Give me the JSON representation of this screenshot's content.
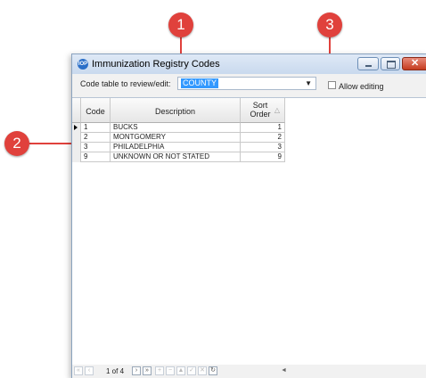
{
  "window": {
    "title": "Immunization Registry Codes",
    "app_icon_text": "IOP"
  },
  "toolbar": {
    "code_table_label": "Code table to review/edit:",
    "code_table_value": "COUNTY",
    "allow_editing_label": "Allow editing",
    "allow_editing_checked": false
  },
  "grid": {
    "columns": [
      "Code",
      "Description",
      "Sort Order"
    ],
    "sorted_column": "Sort Order",
    "rows": [
      {
        "code": "1",
        "description": "BUCKS",
        "sort": "1"
      },
      {
        "code": "2",
        "description": "MONTGOMERY",
        "sort": "2"
      },
      {
        "code": "3",
        "description": "PHILADELPHIA",
        "sort": "3"
      },
      {
        "code": "9",
        "description": "UNKNOWN OR NOT STATED",
        "sort": "9"
      }
    ]
  },
  "navigator": {
    "page_text": "1 of 4"
  },
  "callouts": [
    "1",
    "2",
    "3"
  ],
  "colors": {
    "callout": "#e0413c",
    "selection": "#3399ff"
  }
}
